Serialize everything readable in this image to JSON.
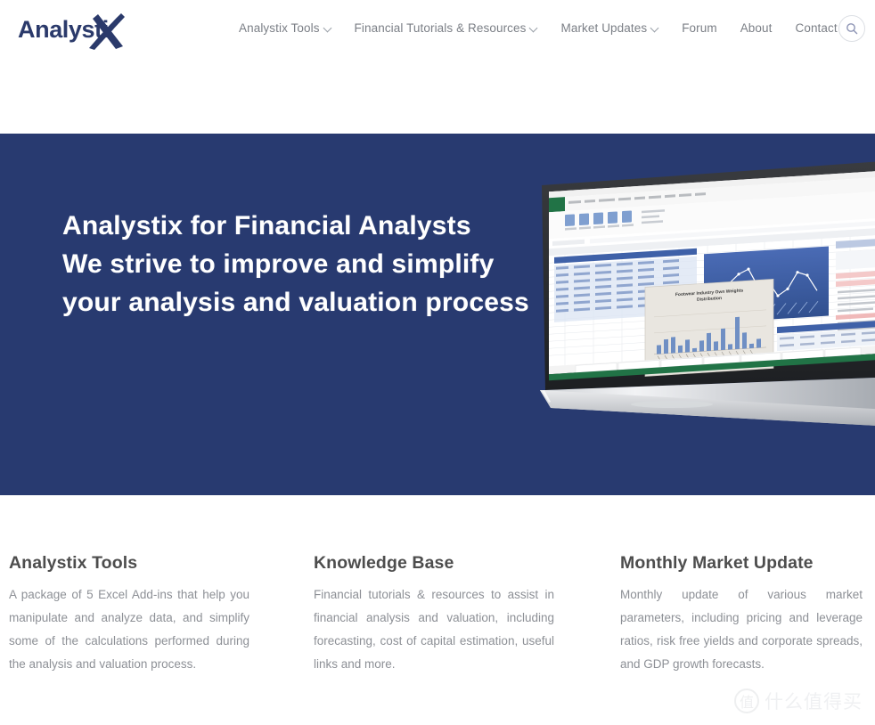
{
  "site": {
    "logo_text_main": "Analysti",
    "logo_text_mark": "X",
    "brand_color": "#2b3a6b"
  },
  "header": {
    "nav": [
      {
        "label": "Analystix Tools",
        "has_dropdown": true
      },
      {
        "label": "Financial Tutorials & Resources",
        "has_dropdown": true
      },
      {
        "label": "Market Updates",
        "has_dropdown": true
      },
      {
        "label": "Forum",
        "has_dropdown": false
      },
      {
        "label": "About",
        "has_dropdown": false
      },
      {
        "label": "Contact",
        "has_dropdown": false
      }
    ],
    "search_icon": "search-icon"
  },
  "hero": {
    "background_color": "#283a70",
    "lines": [
      "Analystix for Financial Analysts",
      "We strive to improve and simplify",
      "your analysis and valuation process"
    ],
    "image_alt": "laptop-excel-spreadsheet-charts",
    "spreadsheet_chart_title": "Footwear Industry Own Weights Distribution"
  },
  "features": [
    {
      "title": "Analystix Tools",
      "body": "A package of 5 Excel Add-ins that help you manipulate and analyze data, and simplify some of the calculations performed during the analysis and valuation process."
    },
    {
      "title": "Knowledge Base",
      "body": "Financial tutorials & resources to assist in financial analysis and valuation, including forecasting, cost of capital estimation, useful links and more."
    },
    {
      "title": "Monthly Market Update",
      "body": "Monthly update of various market parameters, including pricing and leverage ratios, risk free yields and corporate spreads, and GDP growth forecasts."
    }
  ],
  "watermark": {
    "mark": "值",
    "text": "什么值得买"
  }
}
